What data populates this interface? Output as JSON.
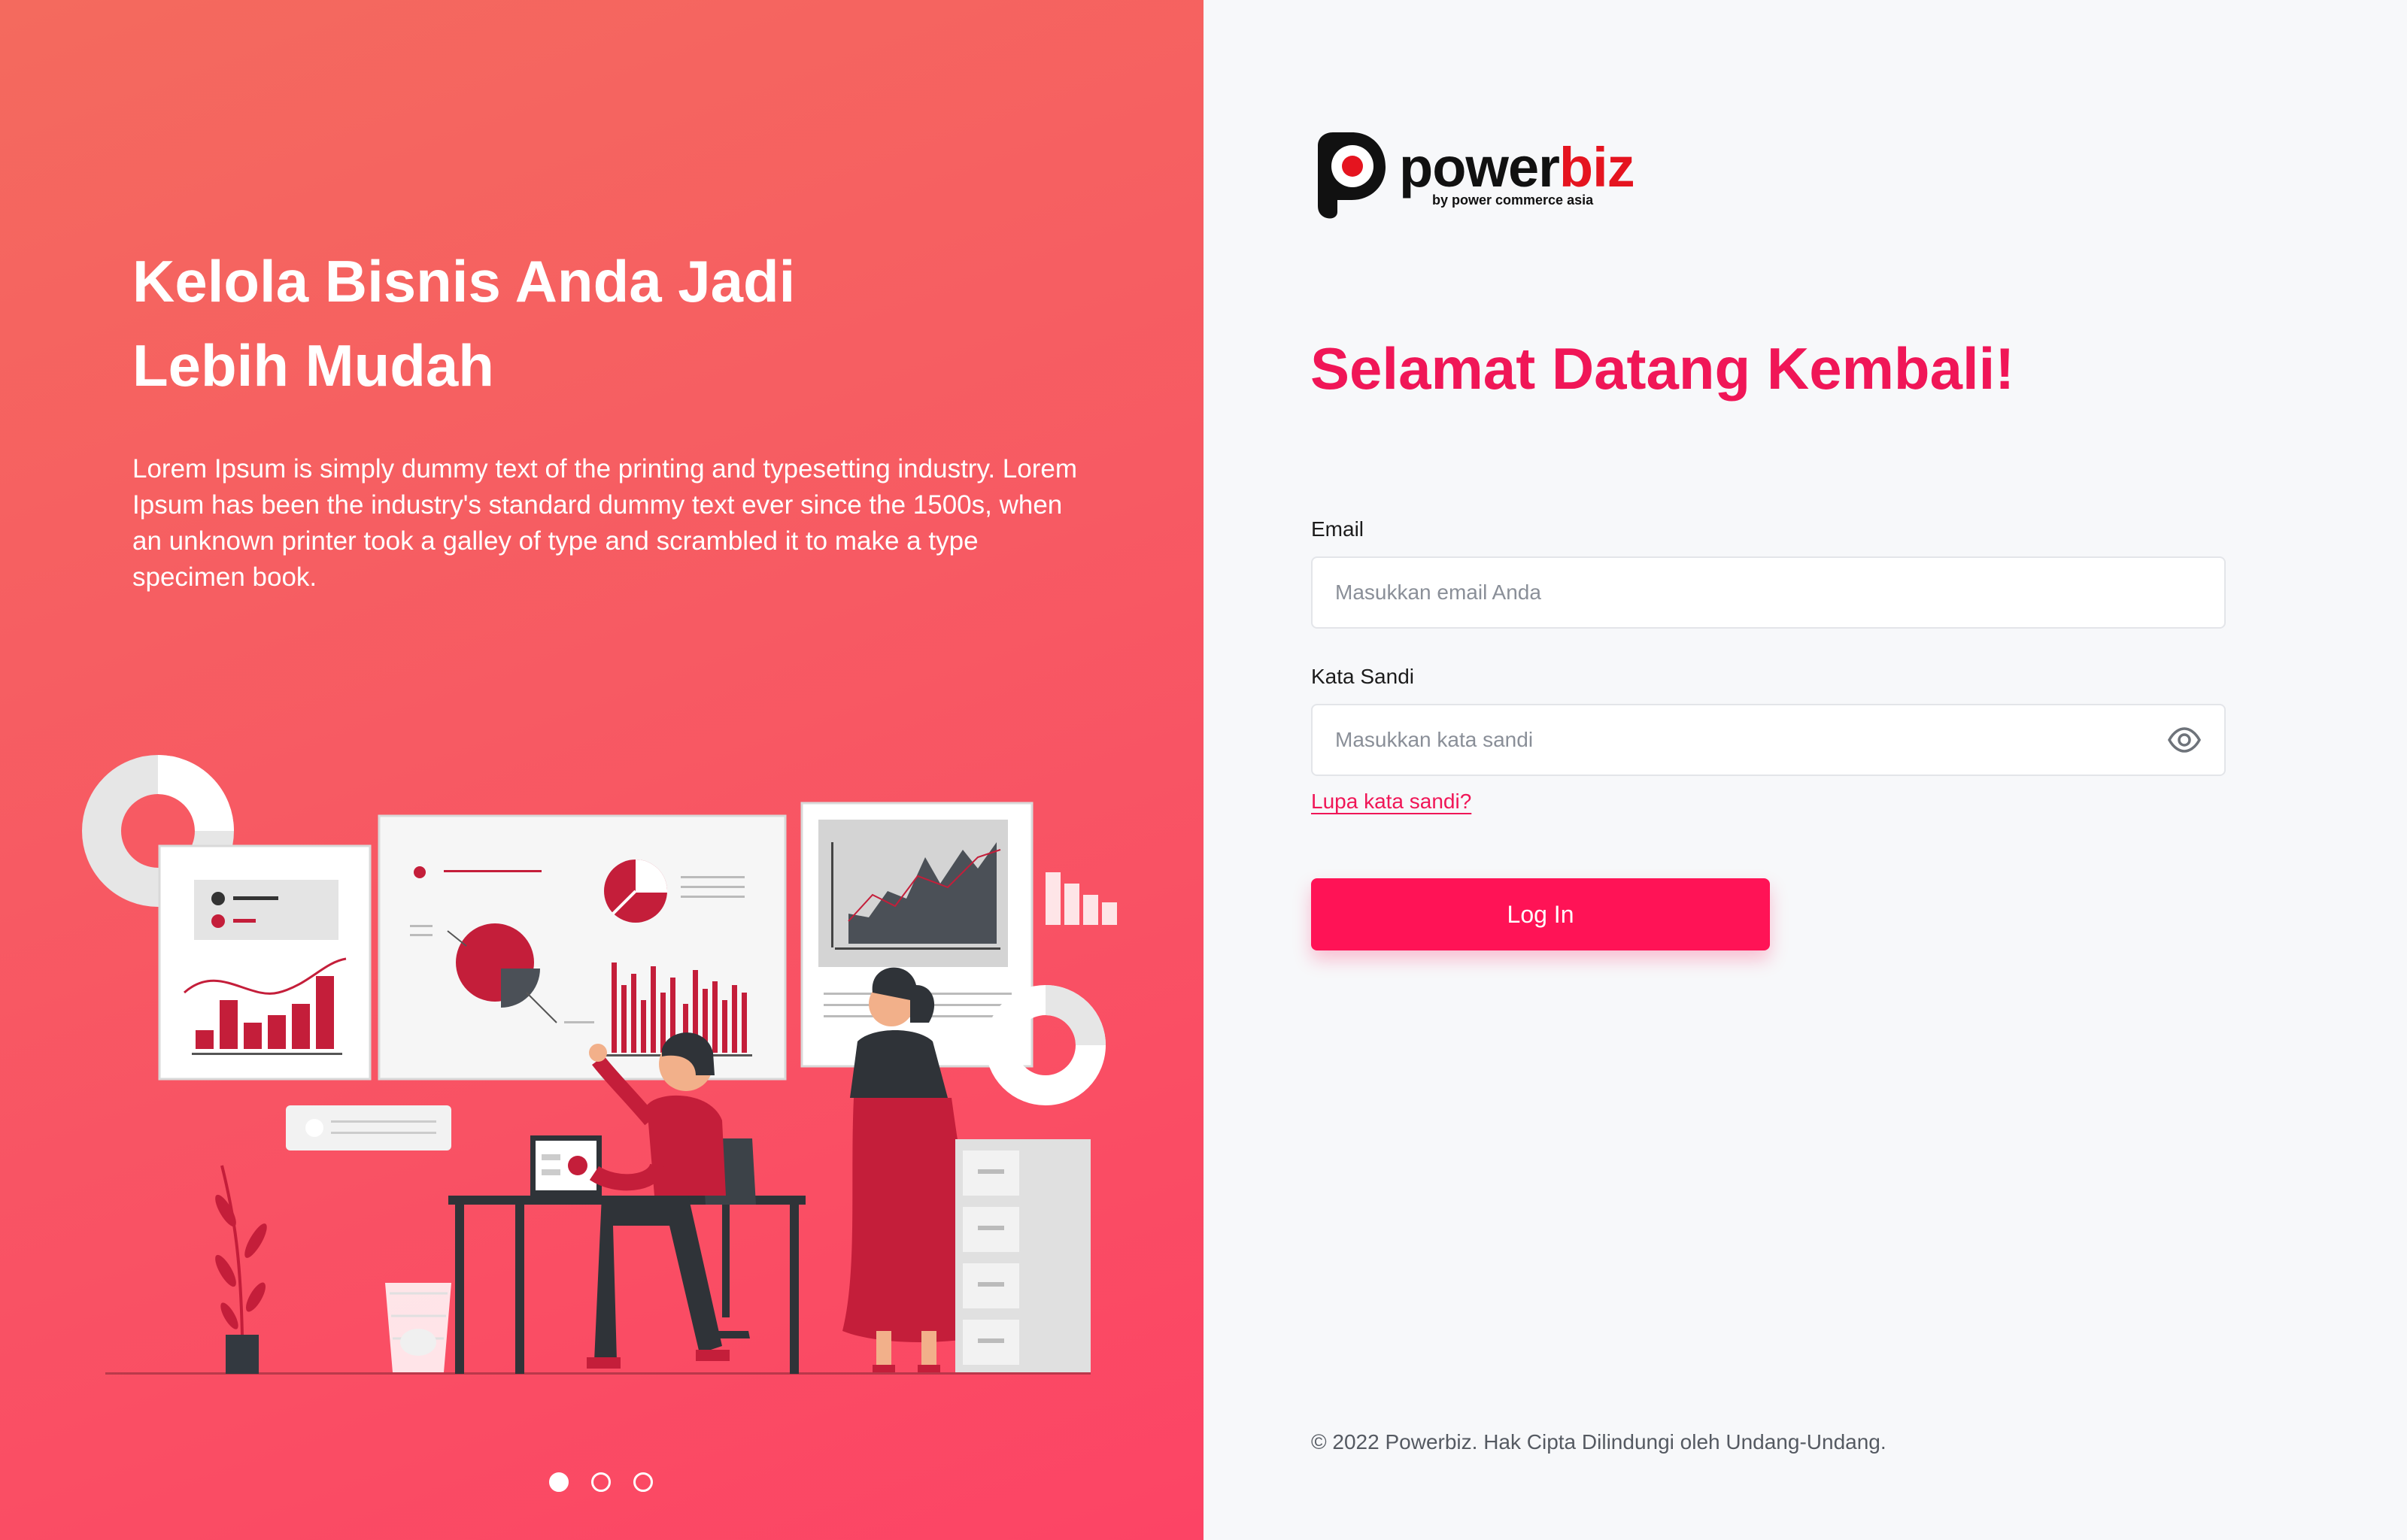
{
  "hero": {
    "title_line1": "Kelola Bisnis Anda Jadi",
    "title_line2": "Lebih Mudah",
    "description": "Lorem Ipsum is simply dummy text of the printing and typesetting industry. Lorem Ipsum has been the industry's standard dummy text ever since the 1500s, when an unknown printer took a galley of type and scrambled it to make a type specimen book."
  },
  "carousel": {
    "active_index": 0,
    "count": 3
  },
  "brand": {
    "name_part1": "power",
    "name_part2": "biz",
    "tagline": "by power commerce asia",
    "colors": {
      "brand_red": "#e5141f",
      "accent_pink": "#f01657",
      "button": "#ff1356"
    }
  },
  "login": {
    "heading": "Selamat Datang Kembali!",
    "email_label": "Email",
    "email_placeholder": "Masukkan email Anda",
    "email_value": "",
    "password_label": "Kata Sandi",
    "password_placeholder": "Masukkan kata sandi",
    "password_value": "",
    "show_password_icon": "eye-icon",
    "forgot_password": "Lupa kata sandi?",
    "submit_label": "Log In"
  },
  "footer": {
    "copyright": "© 2022 Powerbiz. Hak Cipta Dilindungi oleh Undang-Undang."
  }
}
